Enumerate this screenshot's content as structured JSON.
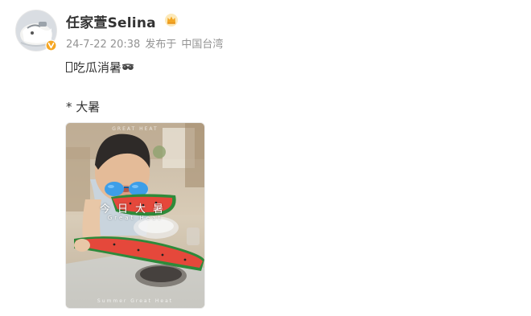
{
  "post": {
    "author": "任家萱Selina",
    "timestamp": "24-7-22 20:38",
    "source": "发布于",
    "location": "中国台湾",
    "text_line1": "吃瓜消暑",
    "text_line2": "* 大暑"
  },
  "photo": {
    "overlay_title": "今日大暑",
    "overlay_subtitle": "Great Heat",
    "overlay_top": "GREAT HEAT",
    "overlay_bottom": "Summer Great Heat"
  },
  "colors": {
    "name": "#333333",
    "meta": "#939393",
    "verify_badge": "#f5a623",
    "watermelon": "#e5483b"
  },
  "icons": {
    "badge": "verified-badge-icon",
    "crown": "crown-icon",
    "emoji": "sunglasses-emoji-icon"
  }
}
